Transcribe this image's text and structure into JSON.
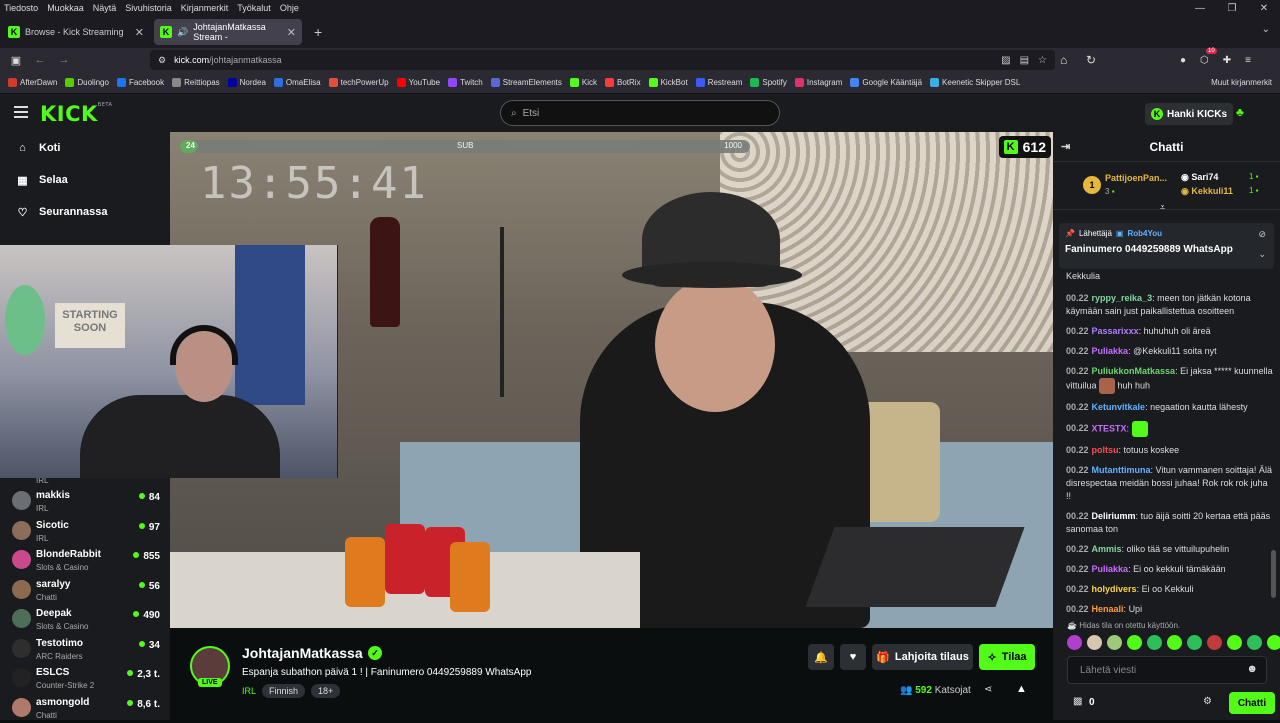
{
  "menubar": {
    "items": [
      "Tiedosto",
      "Muokkaa",
      "Näytä",
      "Sivuhistoria",
      "Kirjanmerkit",
      "Työkalut",
      "Ohje"
    ]
  },
  "tabs": [
    {
      "label": "Browse - Kick Streaming",
      "icon": "kick-icon"
    },
    {
      "label": "JohtajanMatkassa Stream -",
      "icon": "kick-icon"
    }
  ],
  "url": {
    "host": "kick.com",
    "path": "/johtajanmatkassa"
  },
  "extension_badge": "10",
  "bookmarks": [
    {
      "label": "AfterDawn",
      "color": "#d23b2a"
    },
    {
      "label": "Duolingo",
      "color": "#58cc02"
    },
    {
      "label": "Facebook",
      "color": "#1877f2"
    },
    {
      "label": "Reittiopas",
      "color": "#888888"
    },
    {
      "label": "Nordea",
      "color": "#0000a0"
    },
    {
      "label": "OmaElisa",
      "color": "#2f6de1"
    },
    {
      "label": "techPowerUp",
      "color": "#e84c3d"
    },
    {
      "label": "YouTube",
      "color": "#ff0000"
    },
    {
      "label": "Twitch",
      "color": "#9146ff"
    },
    {
      "label": "StreamElements",
      "color": "#5a67d8"
    },
    {
      "label": "Kick",
      "color": "#53fc18"
    },
    {
      "label": "BotRix",
      "color": "#ff3a3a"
    },
    {
      "label": "KickBot",
      "color": "#53fc18"
    },
    {
      "label": "Restream",
      "color": "#3b5bfd"
    },
    {
      "label": "Spotify",
      "color": "#1db954"
    },
    {
      "label": "Instagram",
      "color": "#e1306c"
    },
    {
      "label": "Google Kääntäjä",
      "color": "#4285f4"
    },
    {
      "label": "Keenetic Skipper DSL",
      "color": "#3ab0e2"
    }
  ],
  "bookmarks_other": "Muut kirjanmerkit",
  "header": {
    "logo": "KICK",
    "logo_badge": "BETA",
    "search_placeholder": "Etsi",
    "hanki": "Hanki KICKs"
  },
  "sidebar": {
    "nav": [
      {
        "label": "Koti",
        "icon": "home-icon",
        "glyph": "⌂"
      },
      {
        "label": "Selaa",
        "icon": "browse-icon",
        "glyph": "▦"
      },
      {
        "label": "Seurannassa",
        "icon": "heart-icon",
        "glyph": "♡"
      }
    ],
    "partial_category": "IRL",
    "channels": [
      {
        "name": "makkis",
        "category": "IRL",
        "viewers": "84",
        "color": "#6b6f74"
      },
      {
        "name": "Sicotic",
        "category": "IRL",
        "viewers": "97",
        "color": "#8a6d5a"
      },
      {
        "name": "BlondeRabbit",
        "category": "Slots & Casino",
        "viewers": "855",
        "color": "#c94a8c"
      },
      {
        "name": "saralyy",
        "category": "Chatti",
        "viewers": "56",
        "color": "#8c6a50"
      },
      {
        "name": "Deepak",
        "category": "Slots & Casino",
        "viewers": "490",
        "color": "#4f6e58"
      },
      {
        "name": "Testotimo",
        "category": "ARC Raiders",
        "viewers": "34",
        "color": "#2e2e2e"
      },
      {
        "name": "ESLCS",
        "category": "Counter-Strike 2",
        "viewers": "2,3 t.",
        "color": "#222222"
      },
      {
        "name": "asmongold",
        "category": "Chatti",
        "viewers": "8,6 t.",
        "color": "#b07a6a"
      }
    ]
  },
  "player": {
    "sub_goal_current": "24",
    "sub_goal_label": "SUB",
    "sub_goal_target": "1000",
    "sub_progress": 0.024,
    "timer": "13:55:41",
    "kick_count": "612",
    "cam_poster": "STARTING SOON"
  },
  "stream": {
    "streamer": "JohtajanMatkassa",
    "live": "LIVE",
    "title": "Espanja subathon päivä 1 ! | Faninumero 0449259889 WhatsApp",
    "category": "IRL",
    "tags": [
      "Finnish",
      "18+"
    ],
    "gift_label": "Lahjoita tilaus",
    "subscribe_label": "Tilaa",
    "viewers": "592",
    "viewers_label": "Katsojat"
  },
  "chat": {
    "title": "Chatti",
    "leader1": {
      "name": "PattijoenPan...",
      "count": "3"
    },
    "leader2": {
      "name": "Sari74",
      "count": "1"
    },
    "leader3": {
      "name": "Kekkuli11",
      "count": "1"
    },
    "pinned_by_label": "Lähettäjä",
    "pinned_by": "Rob4You",
    "pinned_text": "Faninumero 0449259889 WhatsApp",
    "first_fragment": "Kekkulia",
    "messages": [
      {
        "time": "00.22",
        "user": "ryppy_reika_3",
        "color": "#7fd6a4",
        "text": "meen ton jätkän kotona käymään sain just paikallistettua osoitteen"
      },
      {
        "time": "00.22",
        "user": "Passarixxx",
        "color": "#b07cff",
        "text": "huhuhuh oli äreä"
      },
      {
        "time": "00.22",
        "user": "Puliakka",
        "color": "#c86dff",
        "text": "@Kekkuli11 soita nyt"
      },
      {
        "time": "00.22",
        "user": "PuliukkonMatkassa",
        "color": "#6dd46d",
        "text": "Ei jaksa ***** kuunnella vittuilua [emote] huh huh"
      },
      {
        "time": "00.22",
        "user": "Ketunvitkale",
        "color": "#5fb3ff",
        "text": "negaation kautta lähesty"
      },
      {
        "time": "00.22",
        "user": "XTESTX",
        "color": "#c86dff",
        "text": "[emote]"
      },
      {
        "time": "00.22",
        "user": "poltsu",
        "color": "#ff4d4d",
        "text": "totuus koskee"
      },
      {
        "time": "00.22",
        "user": "Mutanttimuna",
        "color": "#5fb3ff",
        "text": "Vitun vammanen soittaja! Älä disrespectaa meidän bossi juhaa! Rok rok rok juha !!"
      },
      {
        "time": "00.22",
        "user": "Deliriumm",
        "color": "#ffffff",
        "text": "tuo äijä soitti 20 kertaa että pääs sanomaa ton"
      },
      {
        "time": "00.22",
        "user": "Ammis",
        "color": "#7fd6a4",
        "text": "oliko tää se vittuilupuhelin"
      },
      {
        "time": "00.22",
        "user": "Puliakka",
        "color": "#c86dff",
        "text": "Ei oo kekkuli tämäkään"
      },
      {
        "time": "00.22",
        "user": "holydivers",
        "color": "#ffd23f",
        "text": "Ei oo Kekkuli"
      },
      {
        "time": "00.22",
        "user": "Henaali",
        "color": "#ff9a3c",
        "text": "Upi"
      }
    ],
    "slow_mode": "Hidas tila on otettu käyttöön.",
    "input_placeholder": "Lähetä viesti",
    "points": "0",
    "send_label": "Chatti"
  }
}
